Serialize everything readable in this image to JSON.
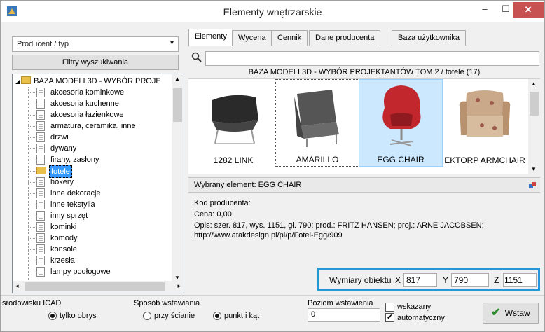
{
  "window": {
    "title": "Elementy wnętrzarskie",
    "min_glyph": "–",
    "max_glyph": "☐",
    "close_glyph": "✕"
  },
  "left": {
    "combo_value": "Producent / typ",
    "filter_button": "Filtry wyszukiwania",
    "tree": {
      "root": "BAZA MODELI 3D - WYBÓR PROJE",
      "items": [
        "akcesoria kominkowe",
        "akcesoria kuchenne",
        "akcesoria łazienkowe",
        "armatura, ceramika, inne",
        "drzwi",
        "dywany",
        "firany, zasłony",
        "fotele",
        "hokery",
        "inne dekoracje",
        "inne tekstylia",
        "inny sprzęt",
        "kominki",
        "komody",
        "konsole",
        "krzesła",
        "lampy podłogowe"
      ],
      "selected_index": 7
    }
  },
  "tabs": [
    "Elementy",
    "Wycena",
    "Cennik",
    "Dane producenta",
    "Baza użytkownika"
  ],
  "gallery": {
    "header": "BAZA MODELI 3D - WYBÓR PROJEKTANTÓW TOM 2 / fotele (17)",
    "items": [
      {
        "label": "1282 LINK"
      },
      {
        "label": "AMARILLO"
      },
      {
        "label": "EGG CHAIR"
      },
      {
        "label": "EKTORP ARMCHAIR"
      }
    ]
  },
  "selected": {
    "label": "Wybrany element: EGG CHAIR",
    "kod": "Kod producenta:",
    "cena": "Cena: 0,00",
    "opis": "Opis: szer. 817, wys. 1151, gł. 790; prod.: FRITZ HANSEN; proj.: ARNE JACOBSEN;",
    "url": "http://www.atakdesign.pl/pl/p/Fotel-Egg/909"
  },
  "dims": {
    "label": "Wymiary obiektu",
    "x_label": "X",
    "x": "817",
    "y_label": "Y",
    "y": "790",
    "z_label": "Z",
    "z": "1151"
  },
  "bottom": {
    "icad_label": "środowisku ICAD",
    "icad_option": "tylko obrys",
    "sposob_label": "Sposób wstawiania",
    "sposob_opt1": "przy ścianie",
    "sposob_opt2": "punkt i kąt",
    "poziom_label": "Poziom wstawienia",
    "poziom_value": "0",
    "chk1": "wskazany",
    "chk2": "automatyczny",
    "chk2_mark": "✔",
    "wstaw": "Wstaw",
    "wstaw_tick": "✔"
  },
  "colors": {
    "accent_box": "#2596d8",
    "selection": "#cce8ff",
    "close": "#c75050"
  }
}
